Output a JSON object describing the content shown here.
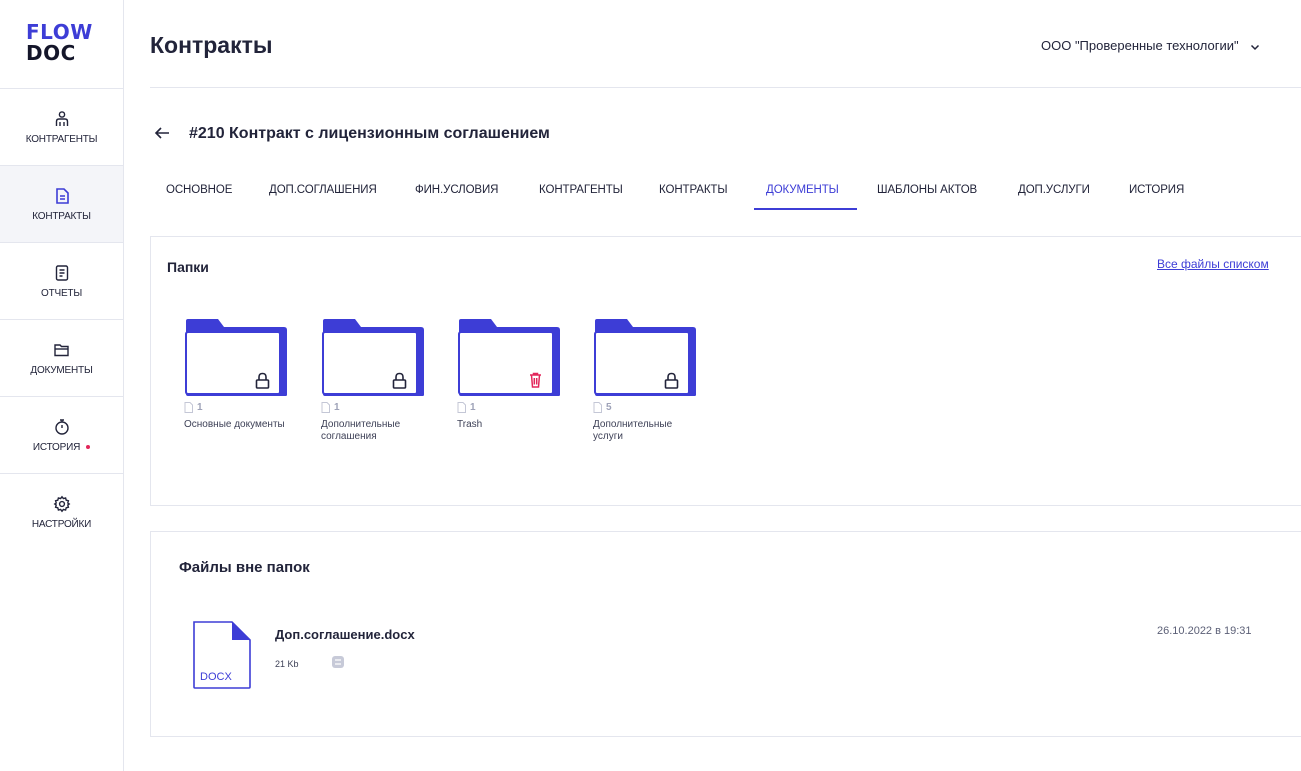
{
  "logo": {
    "line1": "FLOW",
    "line2": "DOC"
  },
  "sidebar": {
    "items": [
      {
        "label": "КОНТРАГЕНТЫ",
        "icon": "person-icon"
      },
      {
        "label": "КОНТРАКТЫ",
        "icon": "document-icon",
        "active": true
      },
      {
        "label": "ОТЧЕТЫ",
        "icon": "report-icon"
      },
      {
        "label": "ДОКУМЕНТЫ",
        "icon": "folder-icon"
      },
      {
        "label": "ИСТОРИЯ",
        "icon": "stopwatch-icon",
        "badge": true
      },
      {
        "label": "НАСТРОЙКИ",
        "icon": "gear-icon"
      }
    ]
  },
  "header": {
    "title": "Контракты",
    "company": "ООО \"Проверенные технологии\""
  },
  "contract": {
    "title": "#210 Контракт с лицензионным соглашением"
  },
  "tabs": [
    {
      "label": "ОСНОВНОЕ"
    },
    {
      "label": "ДОП.СОГЛАШЕНИЯ"
    },
    {
      "label": "ФИН.УСЛОВИЯ"
    },
    {
      "label": "КОНТРАГЕНТЫ"
    },
    {
      "label": "КОНТРАКТЫ"
    },
    {
      "label": "ДОКУМЕНТЫ",
      "active": true
    },
    {
      "label": "ШАБЛОНЫ АКТОВ"
    },
    {
      "label": "ДОП.УСЛУГИ"
    },
    {
      "label": "ИСТОРИЯ"
    }
  ],
  "folders_panel": {
    "title": "Папки",
    "all_files_link": "Все файлы списком",
    "folders": [
      {
        "count": "1",
        "name": "Основные документы",
        "badge_icon": "lock-icon"
      },
      {
        "count": "1",
        "name": "Дополнительные соглашения",
        "badge_icon": "lock-icon"
      },
      {
        "count": "1",
        "name": "Trash",
        "badge_icon": "trash-icon"
      },
      {
        "count": "5",
        "name": "Дополнительные услуги",
        "badge_icon": "lock-icon"
      }
    ]
  },
  "files_panel": {
    "title": "Файлы вне папок",
    "files": [
      {
        "name": "Доп.соглашение.docx",
        "ext": "DOCX",
        "size": "21 Kb",
        "date": "26.10.2022 в 19:31"
      }
    ]
  },
  "colors": {
    "accent": "#3d3dd6",
    "danger": "#e2265a",
    "border": "#e4e6ee"
  }
}
